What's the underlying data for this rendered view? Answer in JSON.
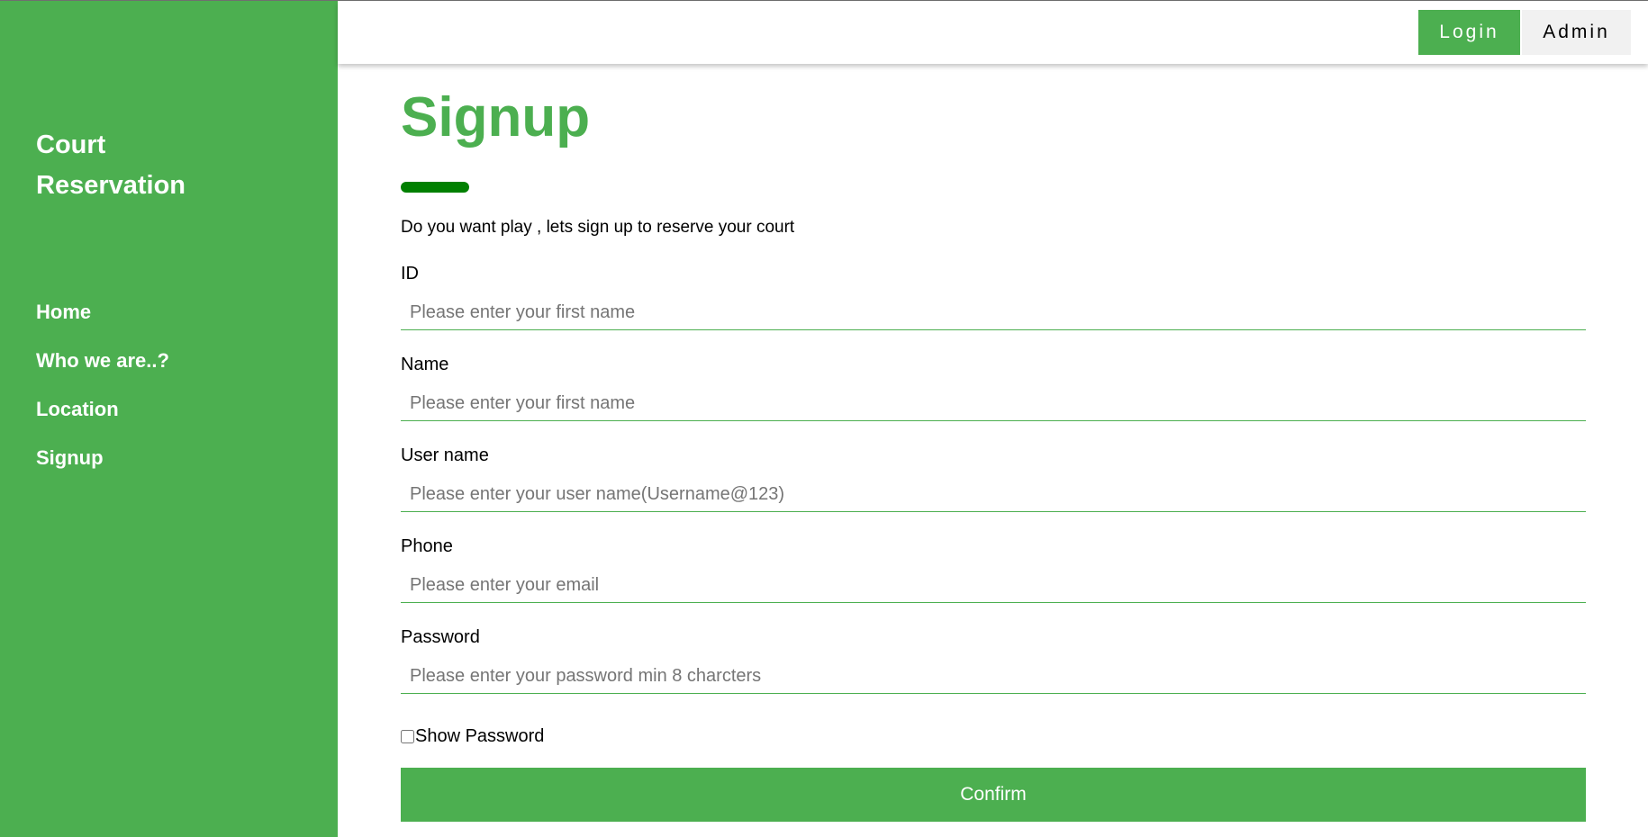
{
  "sidebar": {
    "brand_line1": "Court",
    "brand_line2": "Reservation",
    "nav": [
      {
        "label": "Home"
      },
      {
        "label": "Who we are..?"
      },
      {
        "label": "Location"
      },
      {
        "label": "Signup"
      }
    ]
  },
  "topbar": {
    "login_label": "Login",
    "admin_label": "Admin"
  },
  "main": {
    "title": "Signup",
    "subtitle": "Do you want play , lets sign up to reserve your court",
    "fields": [
      {
        "label": "ID",
        "placeholder": "Please enter your first name",
        "value": ""
      },
      {
        "label": "Name",
        "placeholder": "Please enter your first name",
        "value": ""
      },
      {
        "label": "User name",
        "placeholder": "Please enter your user name(Username@123)",
        "value": ""
      },
      {
        "label": "Phone",
        "placeholder": "Please enter your email",
        "value": ""
      },
      {
        "label": "Password",
        "placeholder": "Please enter your password min 8 charcters",
        "value": ""
      }
    ],
    "show_password_label": "Show Password",
    "show_password_checked": false,
    "confirm_label": "Confirm"
  },
  "colors": {
    "accent": "#4caf50",
    "title_bar": "#008000",
    "admin_bg": "#f1f1f1"
  }
}
